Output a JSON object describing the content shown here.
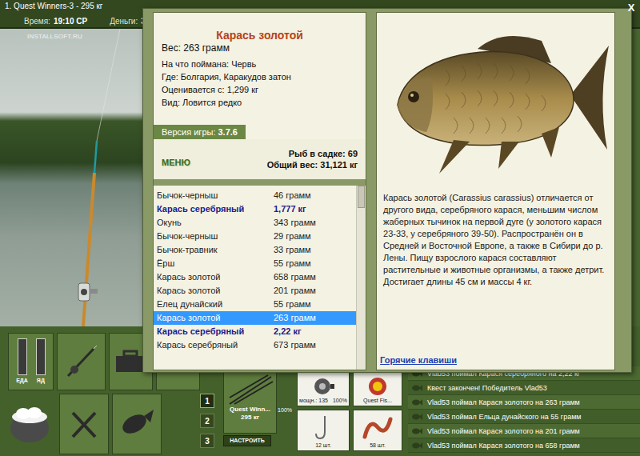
{
  "watermark": "INSTALLSOFT.RU",
  "top_bar": {
    "title": "1. Quest Winners-3 - 295 кг",
    "time_label": "Время:",
    "time": "19:10 СР",
    "money_label": "Деньги:",
    "money": "3"
  },
  "status_meters": [
    {
      "label": "ЕДА",
      "level": 0
    },
    {
      "label": "ЯД",
      "level": 0
    }
  ],
  "toolbar": {
    "map_tile": "M"
  },
  "slots": [
    {
      "label": "1",
      "selected": true
    },
    {
      "label": "2",
      "selected": false
    },
    {
      "label": "3",
      "selected": false
    }
  ],
  "tackle": {
    "rod": {
      "name": "Quest Winn...",
      "weight": "295 кг",
      "condition": "100%"
    },
    "reel": {
      "power": "мощн.: 135",
      "condition": "100%"
    },
    "lure": "Quest Fis...",
    "hook": "12 шт.",
    "bait": "58 шт.",
    "setup_button": "НАСТРОИТЬ"
  },
  "log": [
    "Vlad53 поймал Карася серебряного на 2,22 кг",
    "Квест закончен! Победитель Vlad53",
    "Vlad53 поймал Карася золотого на 263 грамм",
    "Vlad53 поймал Ельца дунайского на 55 грамм",
    "Vlad53 поймал Карася золотого на 201 грамм",
    "Vlad53 поймал Карася золотого на 658 грамм"
  ],
  "dialog": {
    "close": "X",
    "fish": {
      "name": "Карась золотой",
      "weight": "Вес: 263 грамм",
      "details": [
        "На что поймана: Червь",
        "Где: Болгария, Каракудов затон",
        "Оценивается с: 1,299 кг",
        "Вид: Ловится редко"
      ]
    },
    "version": {
      "label": "Версия игры:",
      "value": "3.7.6"
    },
    "menu": "МЕНЮ",
    "keepnet": {
      "count": "Рыб в садке: 69",
      "total": "Общий вес: 31,121 кг"
    },
    "catch_list": [
      {
        "name": "Бычок-черныш",
        "weight": "46 грамм",
        "trophy": false,
        "selected": false
      },
      {
        "name": "Карась серебряный",
        "weight": "1,777 кг",
        "trophy": true,
        "selected": false
      },
      {
        "name": "Окунь",
        "weight": "343 грамм",
        "trophy": false,
        "selected": false
      },
      {
        "name": "Бычок-черныш",
        "weight": "29 грамм",
        "trophy": false,
        "selected": false
      },
      {
        "name": "Бычок-травник",
        "weight": "33 грамм",
        "trophy": false,
        "selected": false
      },
      {
        "name": "Ёрш",
        "weight": "55 грамм",
        "trophy": false,
        "selected": false
      },
      {
        "name": "Карась золотой",
        "weight": "658 грамм",
        "trophy": false,
        "selected": false
      },
      {
        "name": "Карась золотой",
        "weight": "201 грамм",
        "trophy": false,
        "selected": false
      },
      {
        "name": "Елец дунайский",
        "weight": "55 грамм",
        "trophy": false,
        "selected": false
      },
      {
        "name": "Карась золотой",
        "weight": "263 грамм",
        "trophy": false,
        "selected": true
      },
      {
        "name": "Карась серебряный",
        "weight": "2,22 кг",
        "trophy": true,
        "selected": false
      },
      {
        "name": "Карась серебряный",
        "weight": "673 грамм",
        "trophy": false,
        "selected": false
      }
    ],
    "list_scroll": {
      "level": 0.9
    },
    "description": "Карась золотой (Carassius carassius) отличается от другого вида, серебряного карася, меньшим числом жаберных тычинок на первой дуге (у золотого карася 23-33, у серебряного 39-50). Распространён он в Средней и Восточной Европе, а также в Сибири до р. Лены. Пищу взрослого карася составляют растительные и животные организмы, а также детрит. Достигает длины 45 см и массы 4 кг.",
    "hotkeys": "Горячие клавиши"
  }
}
